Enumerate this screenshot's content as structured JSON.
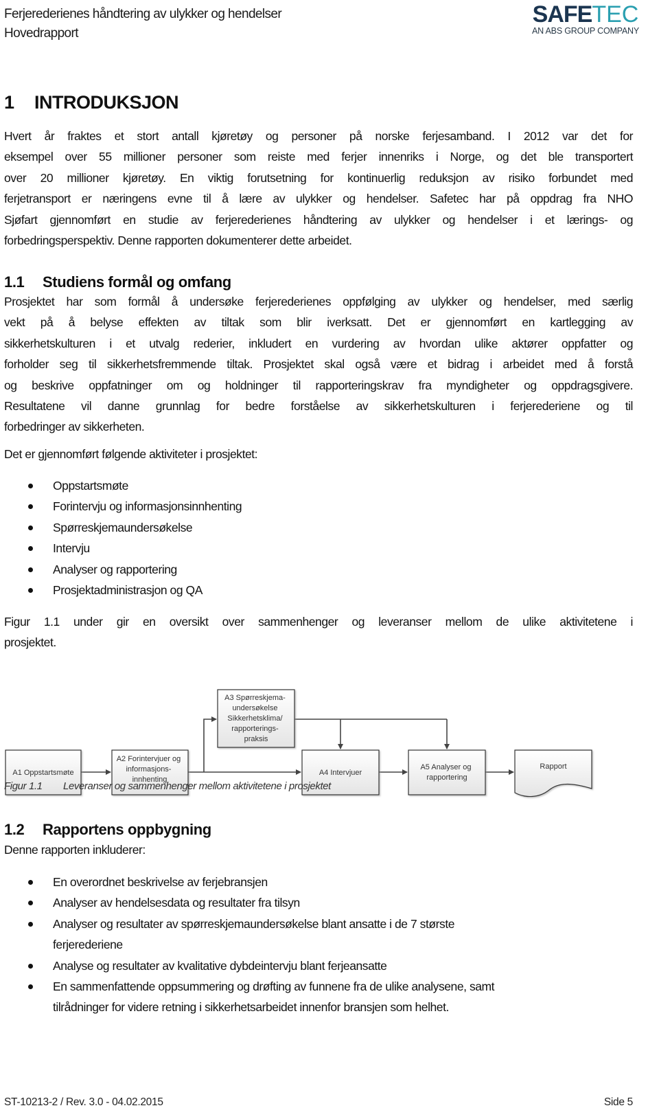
{
  "header": {
    "title": "Ferjerederienes håndtering av ulykker og hendelser",
    "subtitle": "Hovedrapport",
    "logo": {
      "main_bold": "SAFE",
      "main_light": "TEC",
      "tagline": "AN ABS GROUP COMPANY",
      "colors": {
        "primary": "#1b3550",
        "accent": "#2a9fb0"
      }
    }
  },
  "section1": {
    "number": "1",
    "title": "INTRODUKSJON",
    "paragraph_lines": [
      "Hvert år fraktes et stort antall kjøretøy og personer på norske ferjesamband. I 2012 var det for",
      "eksempel over 55 millioner personer som reiste med ferjer innenriks i Norge, og det ble transportert",
      "over 20 millioner kjøretøy. En viktig forutsetning for kontinuerlig reduksjon av risiko forbundet med",
      "ferjetransport er næringens evne til å lære av ulykker og hendelser. Safetec har på oppdrag fra NHO",
      "Sjøfart gjennomført en studie av ferjerederienes håndtering av ulykker og hendelser i et lærings- og",
      "forbedringsperspektiv. Denne rapporten dokumenterer dette arbeidet."
    ]
  },
  "section1_1": {
    "number": "1.1",
    "title": "Studiens formål og omfang",
    "paragraph_lines": [
      "Prosjektet har som formål å undersøke ferjerederienes oppfølging av ulykker og hendelser, med særlig",
      "vekt på å belyse effekten av tiltak som blir iverksatt. Det er gjennomført en kartlegging av",
      "sikkerhetskulturen i et utvalg rederier, inkludert en vurdering av hvordan ulike aktører oppfatter og",
      "forholder seg til sikkerhetsfremmende tiltak. Prosjektet skal også være et bidrag i arbeidet med å forstå",
      "og beskrive oppfatninger om og holdninger til rapporteringskrav fra myndigheter og oppdragsgivere.",
      "Resultatene vil danne grunnlag for bedre forståelse av sikkerhetskulturen i ferjerederiene og til",
      "forbedringer av sikkerheten."
    ],
    "activities_intro": "Det er gjennomført følgende aktiviteter i prosjektet:",
    "activities": [
      "Oppstartsmøte",
      "Forintervju og informasjonsinnhenting",
      "Spørreskjemaundersøkelse",
      "Intervju",
      "Analyser og rapportering",
      "Prosjektadministrasjon og QA"
    ],
    "figure_ref_lines": [
      "Figur 1.1 under gir en oversikt over sammenhenger og leveranser mellom de ulike aktivitetene i",
      "prosjektet."
    ]
  },
  "figure": {
    "nodes": {
      "a1": [
        "A1 Oppstartsmøte"
      ],
      "a2": [
        "A2 Forintervjuer og",
        "informasjons-",
        "innhenting"
      ],
      "a3": [
        "A3 Spørreskjema-",
        "undersøkelse",
        "Sikkerhetsklima/",
        "rapporterings-",
        "praksis"
      ],
      "a4": [
        "A4 Intervjuer"
      ],
      "a5": [
        "A5 Analyser og",
        "rapportering"
      ],
      "report": [
        "Rapport"
      ]
    },
    "caption_label": "Figur 1.1",
    "caption_text": "Leveranser og sammenhenger mellom aktivitetene i prosjektet"
  },
  "section1_2": {
    "number": "1.2",
    "title": "Rapportens oppbygning",
    "intro": "Denne rapporten inkluderer:",
    "items": [
      [
        "En overordnet beskrivelse av ferjebransjen"
      ],
      [
        "Analyser av hendelsesdata og resultater fra tilsyn"
      ],
      [
        "Analyser og resultater av spørreskjemaundersøkelse blant ansatte i de 7 største",
        "ferjerederiene"
      ],
      [
        "Analyse og resultater av kvalitative dybdeintervju blant ferjeansatte"
      ],
      [
        "En sammenfattende oppsummering og drøfting av funnene fra de ulike analysene, samt",
        "tilrådninger for videre retning i sikkerhetsarbeidet innenfor bransjen som helhet."
      ]
    ]
  },
  "footer": {
    "doc_id": "ST-10213-2 / Rev. 3.0 - 04.02.2015",
    "page": "Side 5"
  }
}
